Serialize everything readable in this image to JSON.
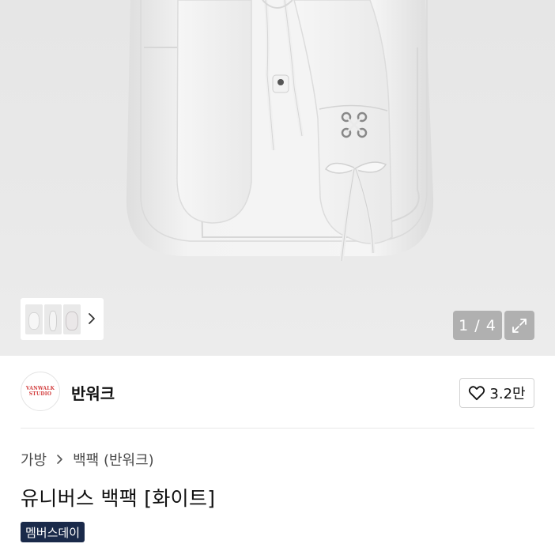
{
  "gallery": {
    "counter": "1 / 4",
    "thumbnails": [
      "thumbnail-front",
      "thumbnail-side",
      "thumbnail-back"
    ],
    "icons": {
      "next": "chevron-right-icon",
      "expand": "expand-arrows-icon"
    }
  },
  "seller": {
    "logo_line1": "VANWALK",
    "logo_line2": "STUDIO",
    "name": "반워크",
    "likes": "3.2만",
    "like_icon": "heart-outline-icon"
  },
  "breadcrumb": {
    "category": "가방",
    "subcategory": "백팩 (반워크)"
  },
  "product": {
    "title": "유니버스 백팩 [화이트]",
    "badge": "멤버스데이"
  },
  "colors": {
    "badge_bg": "#1a2a4a",
    "logo_red": "#d23b3b",
    "overlay_gray": "rgba(128,128,128,0.55)"
  }
}
